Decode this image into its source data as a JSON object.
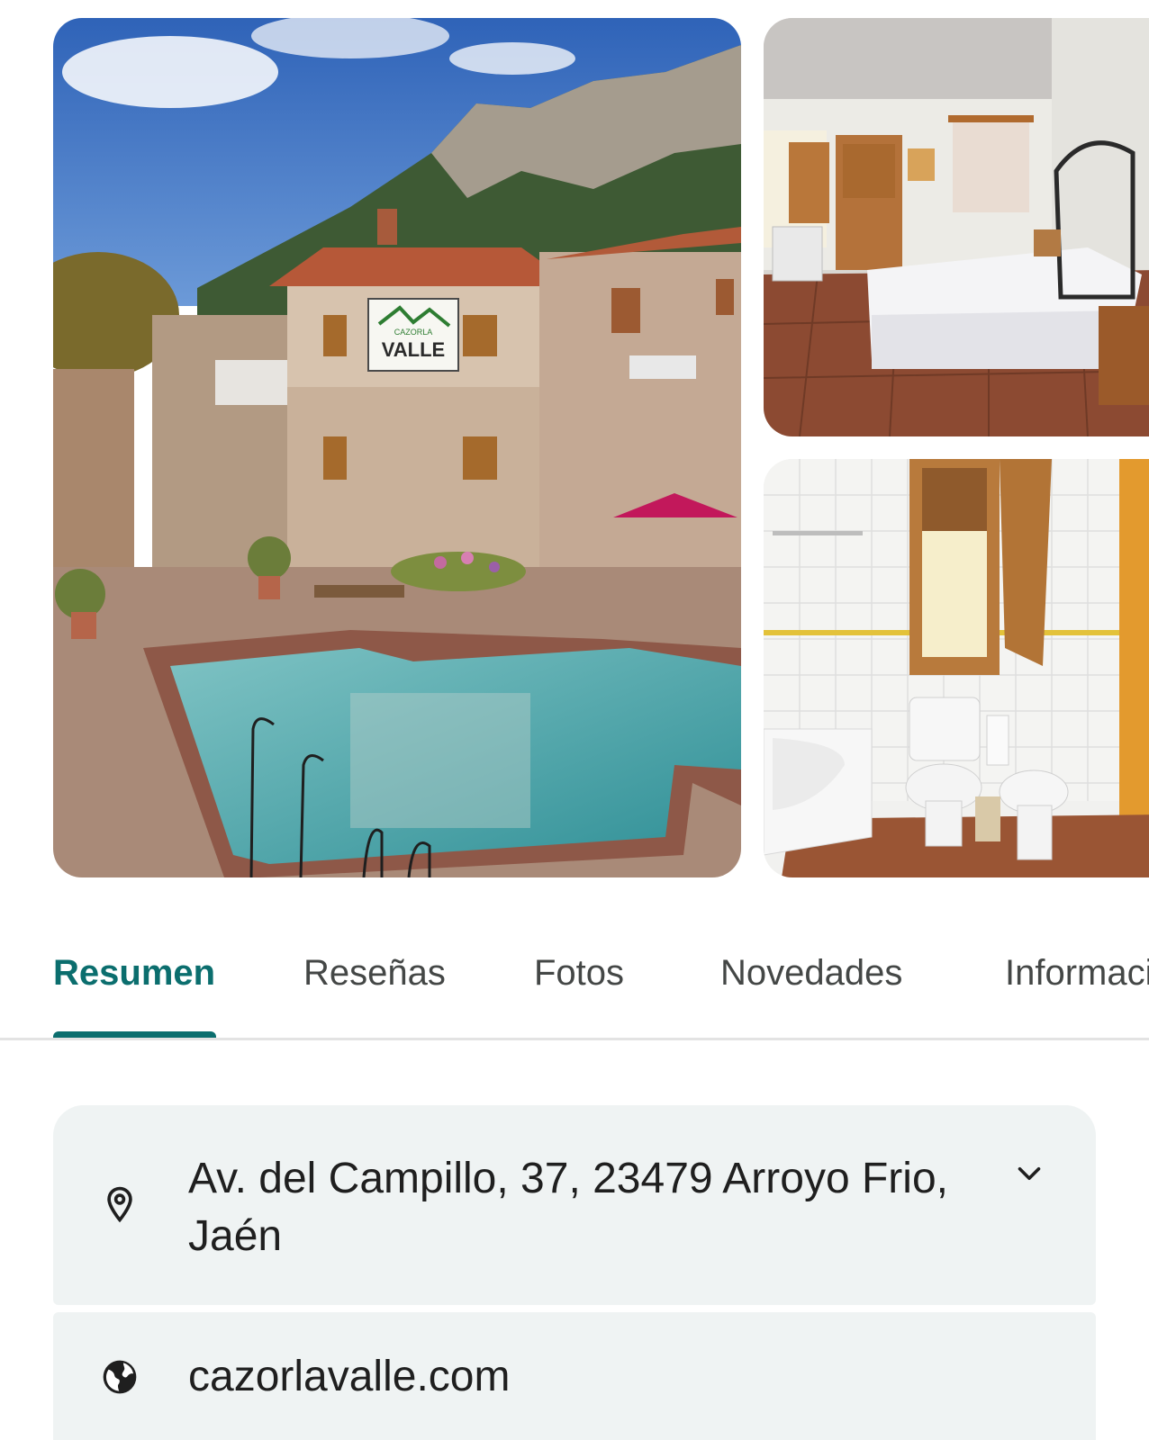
{
  "gallery": {
    "logo": {
      "top": "CAZORLA",
      "main": "VALLE"
    },
    "sign_text": "CAZORLA VALLE"
  },
  "tabs": [
    {
      "label": "Resumen",
      "active": true
    },
    {
      "label": "Reseñas",
      "active": false
    },
    {
      "label": "Fotos",
      "active": false
    },
    {
      "label": "Novedades",
      "active": false
    },
    {
      "label": "Información",
      "active": false
    }
  ],
  "info": {
    "address": "Av. del Campillo, 37, 23479 Arroyo Frio, Jaén",
    "website": "cazorlavalle.com",
    "icons": {
      "address": "location-pin-icon",
      "website": "globe-icon",
      "expand": "chevron-down-icon"
    }
  },
  "colors": {
    "accent": "#0b6e6e",
    "card_bg": "#eff3f3",
    "tab_text": "#444746"
  }
}
